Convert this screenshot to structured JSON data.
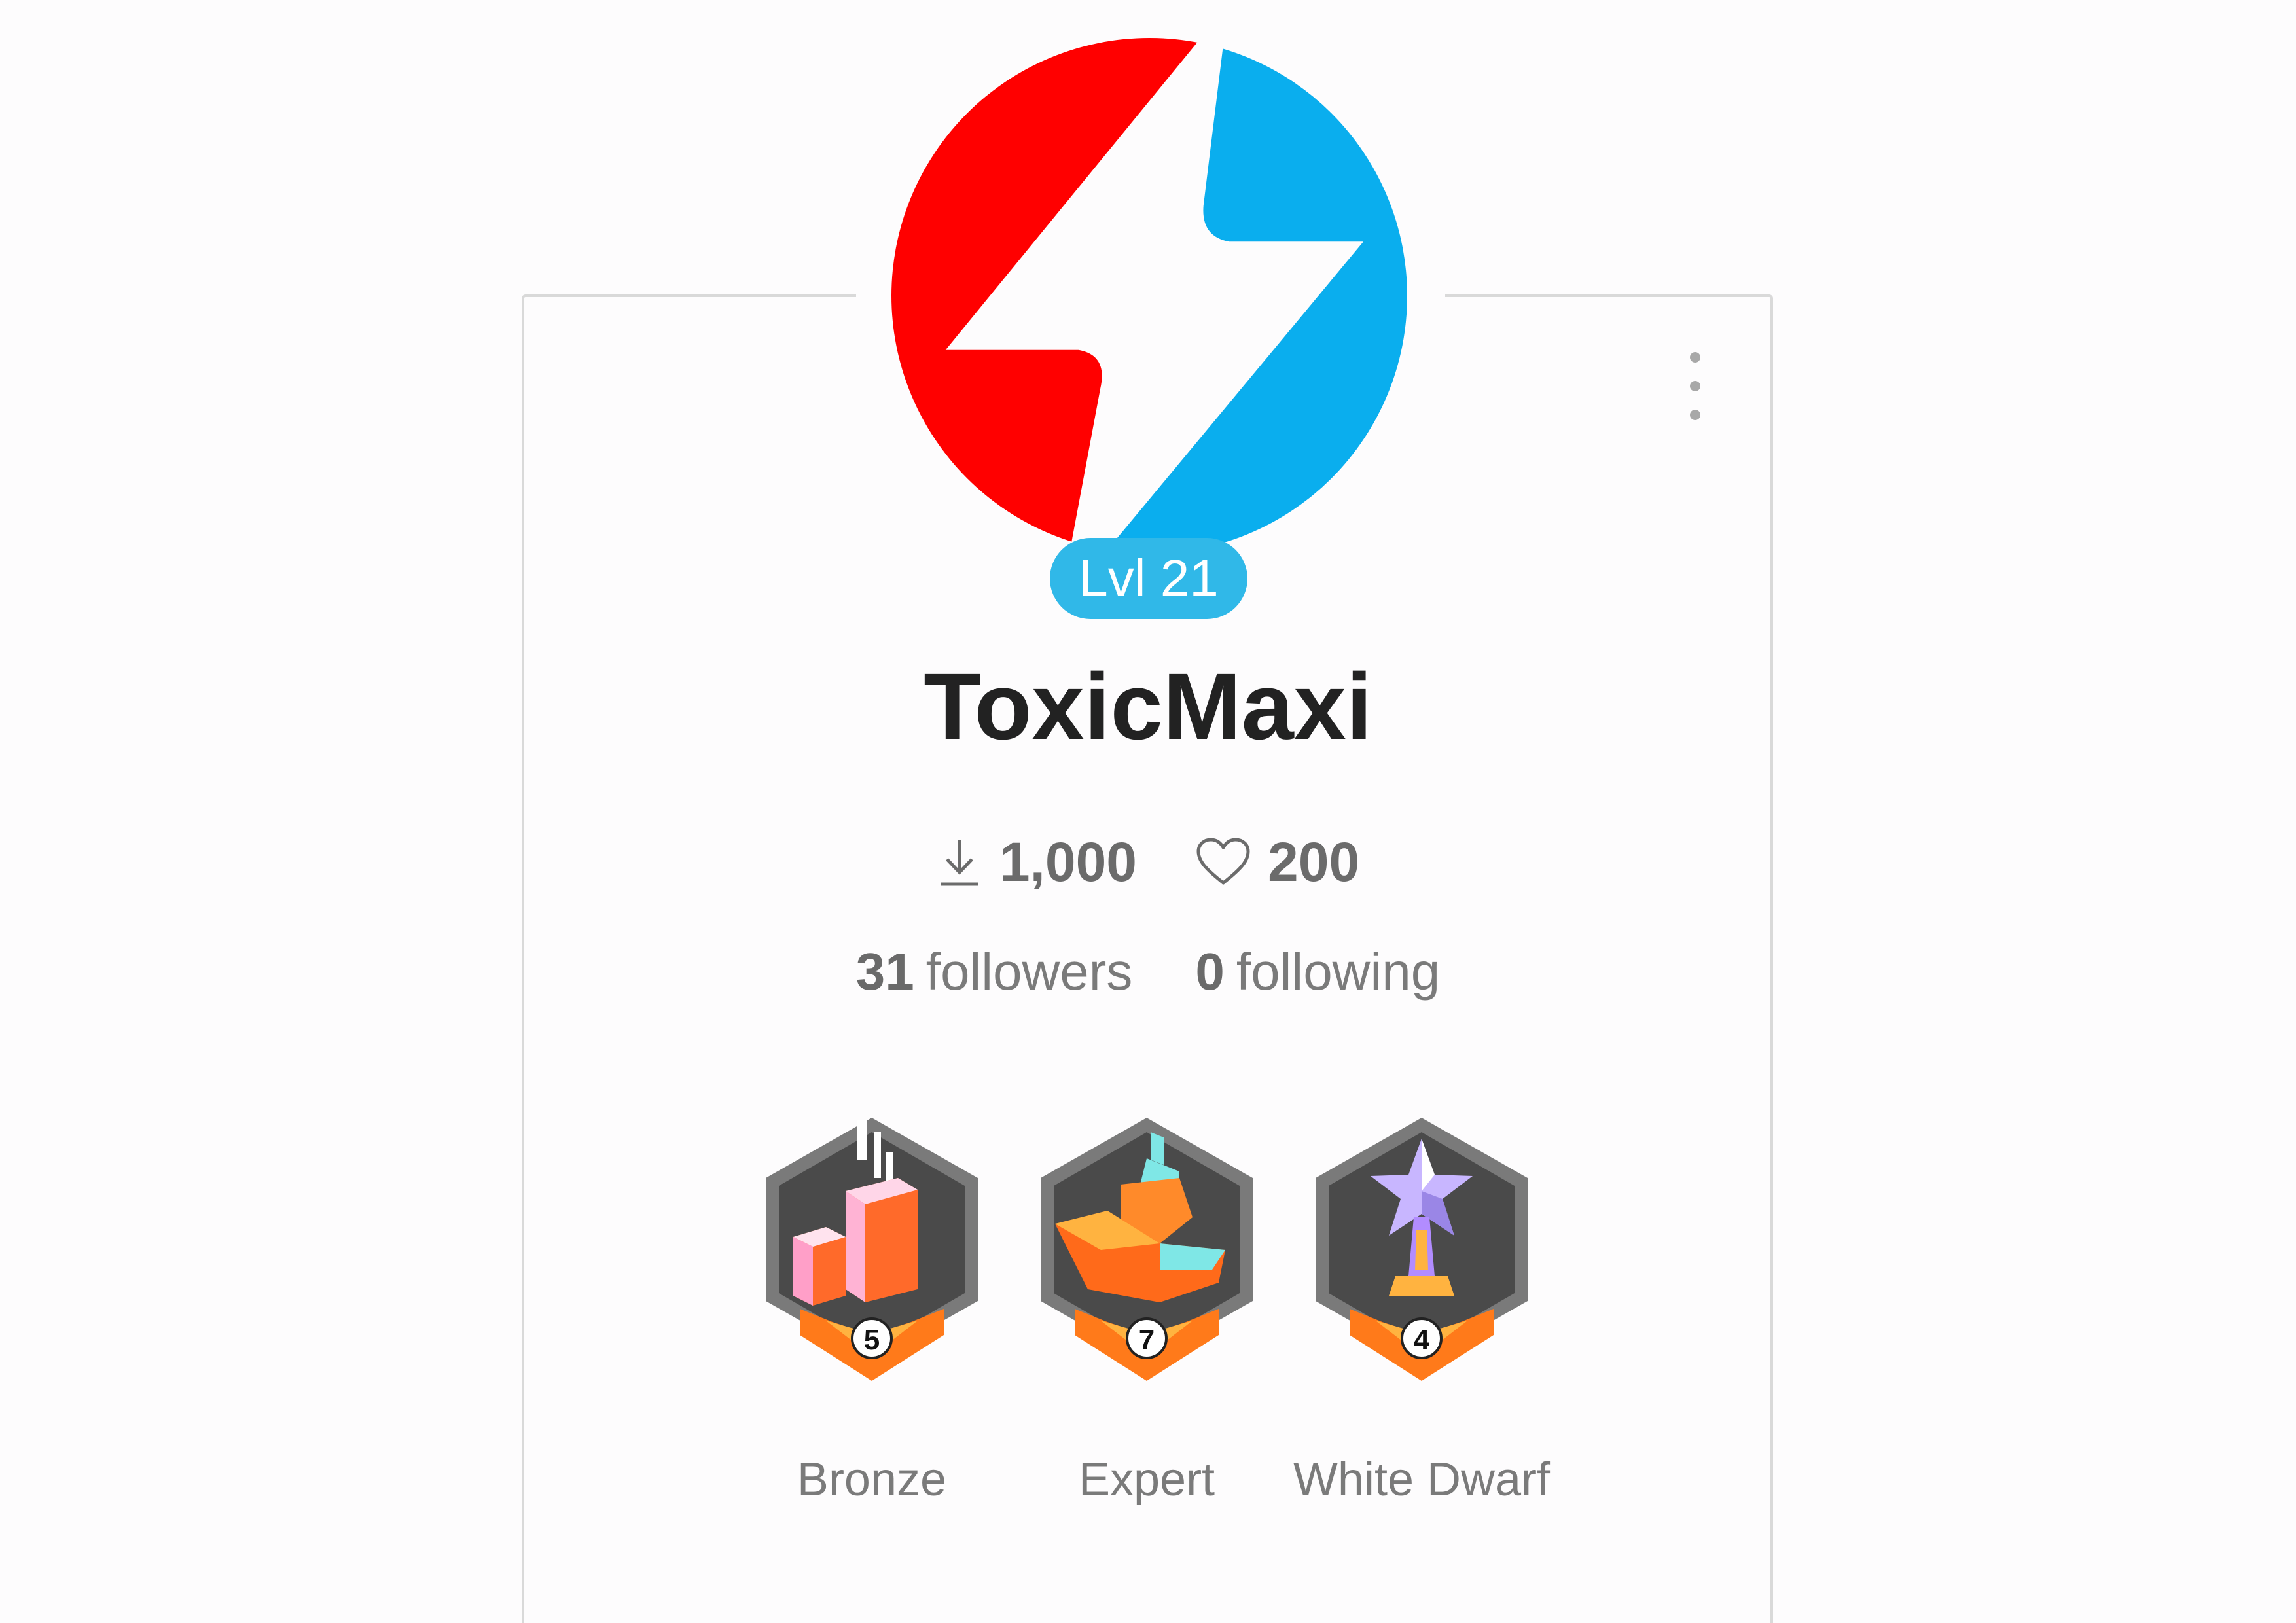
{
  "profile": {
    "level_label": "Lvl 21",
    "username": "ToxicMaxi",
    "avatar_icon": "lightning-bolt-logo-icon",
    "avatar_colors": {
      "left": "#ff0000",
      "right": "#0aaeee"
    }
  },
  "stats": {
    "downloads": {
      "icon": "download-icon",
      "value": "1,000"
    },
    "likes": {
      "icon": "heart-icon",
      "value": "200"
    }
  },
  "social": {
    "followers_count": "31",
    "followers_label": "followers",
    "following_count": "0",
    "following_label": "following"
  },
  "badges": [
    {
      "name": "Bronze",
      "level": "5",
      "icon": "building-blocks-badge-icon"
    },
    {
      "name": "Expert",
      "level": "7",
      "icon": "boat-badge-icon"
    },
    {
      "name": "White Dwarf",
      "level": "4",
      "icon": "star-trophy-badge-icon"
    }
  ],
  "menu": {
    "icon": "more-vertical-icon"
  }
}
